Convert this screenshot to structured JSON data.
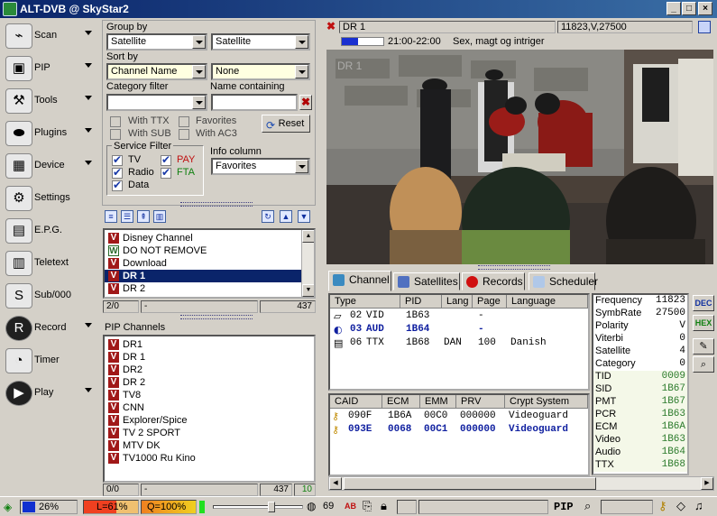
{
  "window": {
    "title": "ALT-DVB @ SkyStar2"
  },
  "sidebar": {
    "items": [
      {
        "label": "Scan",
        "icon": "scan-icon",
        "arrow": true
      },
      {
        "label": "PIP",
        "icon": "pip-icon",
        "arrow": true
      },
      {
        "label": "Tools",
        "icon": "tools-icon",
        "arrow": true
      },
      {
        "label": "Plugins",
        "icon": "plugins-icon",
        "arrow": true
      },
      {
        "label": "Device",
        "icon": "device-icon",
        "arrow": true
      },
      {
        "label": "Settings",
        "icon": "settings-icon",
        "arrow": false
      },
      {
        "label": "E.P.G.",
        "icon": "epg-icon",
        "arrow": false
      },
      {
        "label": "Teletext",
        "icon": "teletext-icon",
        "arrow": false
      },
      {
        "label": "Sub/000",
        "icon": "subtitles-icon",
        "arrow": false
      },
      {
        "label": "Record",
        "icon": "record-icon",
        "arrow": true
      },
      {
        "label": "Timer",
        "icon": "timer-icon",
        "arrow": false
      },
      {
        "label": "Play",
        "icon": "play-icon",
        "arrow": true
      }
    ]
  },
  "filters": {
    "group_by_label": "Group by",
    "group_by_1": "Satellite",
    "group_by_2": "Satellite",
    "sort_by_label": "Sort by",
    "sort_by_1": "Channel Name",
    "sort_by_2": "None",
    "category_label": "Category filter",
    "category_value": "",
    "name_label": "Name containing",
    "name_value": "",
    "with_ttx": "With TTX",
    "with_sub": "With SUB",
    "favorites": "Favorites",
    "with_ac3": "With AC3",
    "reset": "Reset",
    "service_filter_label": "Service Filter",
    "tv": "TV",
    "radio": "Radio",
    "data": "Data",
    "pay": "PAY",
    "fta": "FTA",
    "info_column_label": "Info column",
    "info_column_value": "Favorites"
  },
  "channel_list": {
    "items": [
      {
        "name": "Disney Channel",
        "badge": "V",
        "selected": false
      },
      {
        "name": "DO NOT REMOVE",
        "badge": "W",
        "selected": false
      },
      {
        "name": "Download",
        "badge": "V",
        "selected": false
      },
      {
        "name": "DR 1",
        "badge": "V",
        "selected": true
      },
      {
        "name": "DR 2",
        "badge": "V",
        "selected": false
      }
    ],
    "status_pos": "2/0",
    "status_dash": "-",
    "status_count": "437"
  },
  "pip": {
    "header": "PIP Channels",
    "items": [
      "DR1",
      "DR 1",
      "DR2",
      "DR 2",
      "TV8",
      "CNN",
      "Explorer/Spice",
      "TV 2 SPORT",
      "MTV DK",
      "TV1000 Ru Kino"
    ],
    "status_pos": "0/0",
    "status_dash": "-",
    "status_count": "437",
    "status_green": "10"
  },
  "video": {
    "channel": "DR 1",
    "tp": "11823,V,27500",
    "time": "21:00-22:00",
    "program": "Sex, magt og intriger",
    "progress_pct": 40
  },
  "tabs": [
    "Channel",
    "Satellites",
    "Records",
    "Scheduler"
  ],
  "pids": {
    "headers": [
      "Type",
      "PID",
      "Lang",
      "Page",
      "Language"
    ],
    "rows": [
      {
        "num": "02",
        "type": "VID",
        "pid": "1B63",
        "lang": "",
        "page": "-",
        "language": "",
        "bold": false
      },
      {
        "num": "03",
        "type": "AUD",
        "pid": "1B64",
        "lang": "",
        "page": "-",
        "language": "",
        "bold": true
      },
      {
        "num": "06",
        "type": "TTX",
        "pid": "1B68",
        "lang": "DAN",
        "page": "100",
        "language": "Danish",
        "bold": false
      }
    ]
  },
  "caids": {
    "headers": [
      "CAID",
      "ECM",
      "EMM",
      "PRV",
      "Crypt System"
    ],
    "rows": [
      {
        "caid": "090F",
        "ecm": "1B6A",
        "emm": "00C0",
        "prv": "000000",
        "system": "Videoguard",
        "bold": false
      },
      {
        "caid": "093E",
        "ecm": "0068",
        "emm": "00C1",
        "prv": "000000",
        "system": "Videoguard",
        "bold": true
      }
    ]
  },
  "info": [
    {
      "k": "Frequency",
      "v": "11823",
      "g": false
    },
    {
      "k": "SymbRate",
      "v": "27500",
      "g": false
    },
    {
      "k": "Polarity",
      "v": "V",
      "g": false
    },
    {
      "k": "Viterbi",
      "v": "0",
      "g": false
    },
    {
      "k": "Satellite",
      "v": "4",
      "g": false
    },
    {
      "k": "Category",
      "v": "0",
      "g": false
    },
    {
      "k": "TID",
      "v": "0009",
      "g": true
    },
    {
      "k": "SID",
      "v": "1B67",
      "g": true
    },
    {
      "k": "PMT",
      "v": "1B67",
      "g": true
    },
    {
      "k": "PCR",
      "v": "1B63",
      "g": true
    },
    {
      "k": "ECM",
      "v": "1B6A",
      "g": true
    },
    {
      "k": "Video",
      "v": "1B63",
      "g": true
    },
    {
      "k": "Audio",
      "v": "1B64",
      "g": true
    },
    {
      "k": "TTX",
      "v": "1B68",
      "g": true
    }
  ],
  "side_buttons": {
    "dec": "DEC",
    "hex": "HEX"
  },
  "status": {
    "signal": "26%",
    "level": "L=61%",
    "quality": "Q=100%",
    "volume": "69",
    "pip": "PIP"
  },
  "colors": {
    "title_start": "#0a246a",
    "title_end": "#3a6ea5",
    "selected": "#0a246a",
    "badge": "#a01818"
  }
}
